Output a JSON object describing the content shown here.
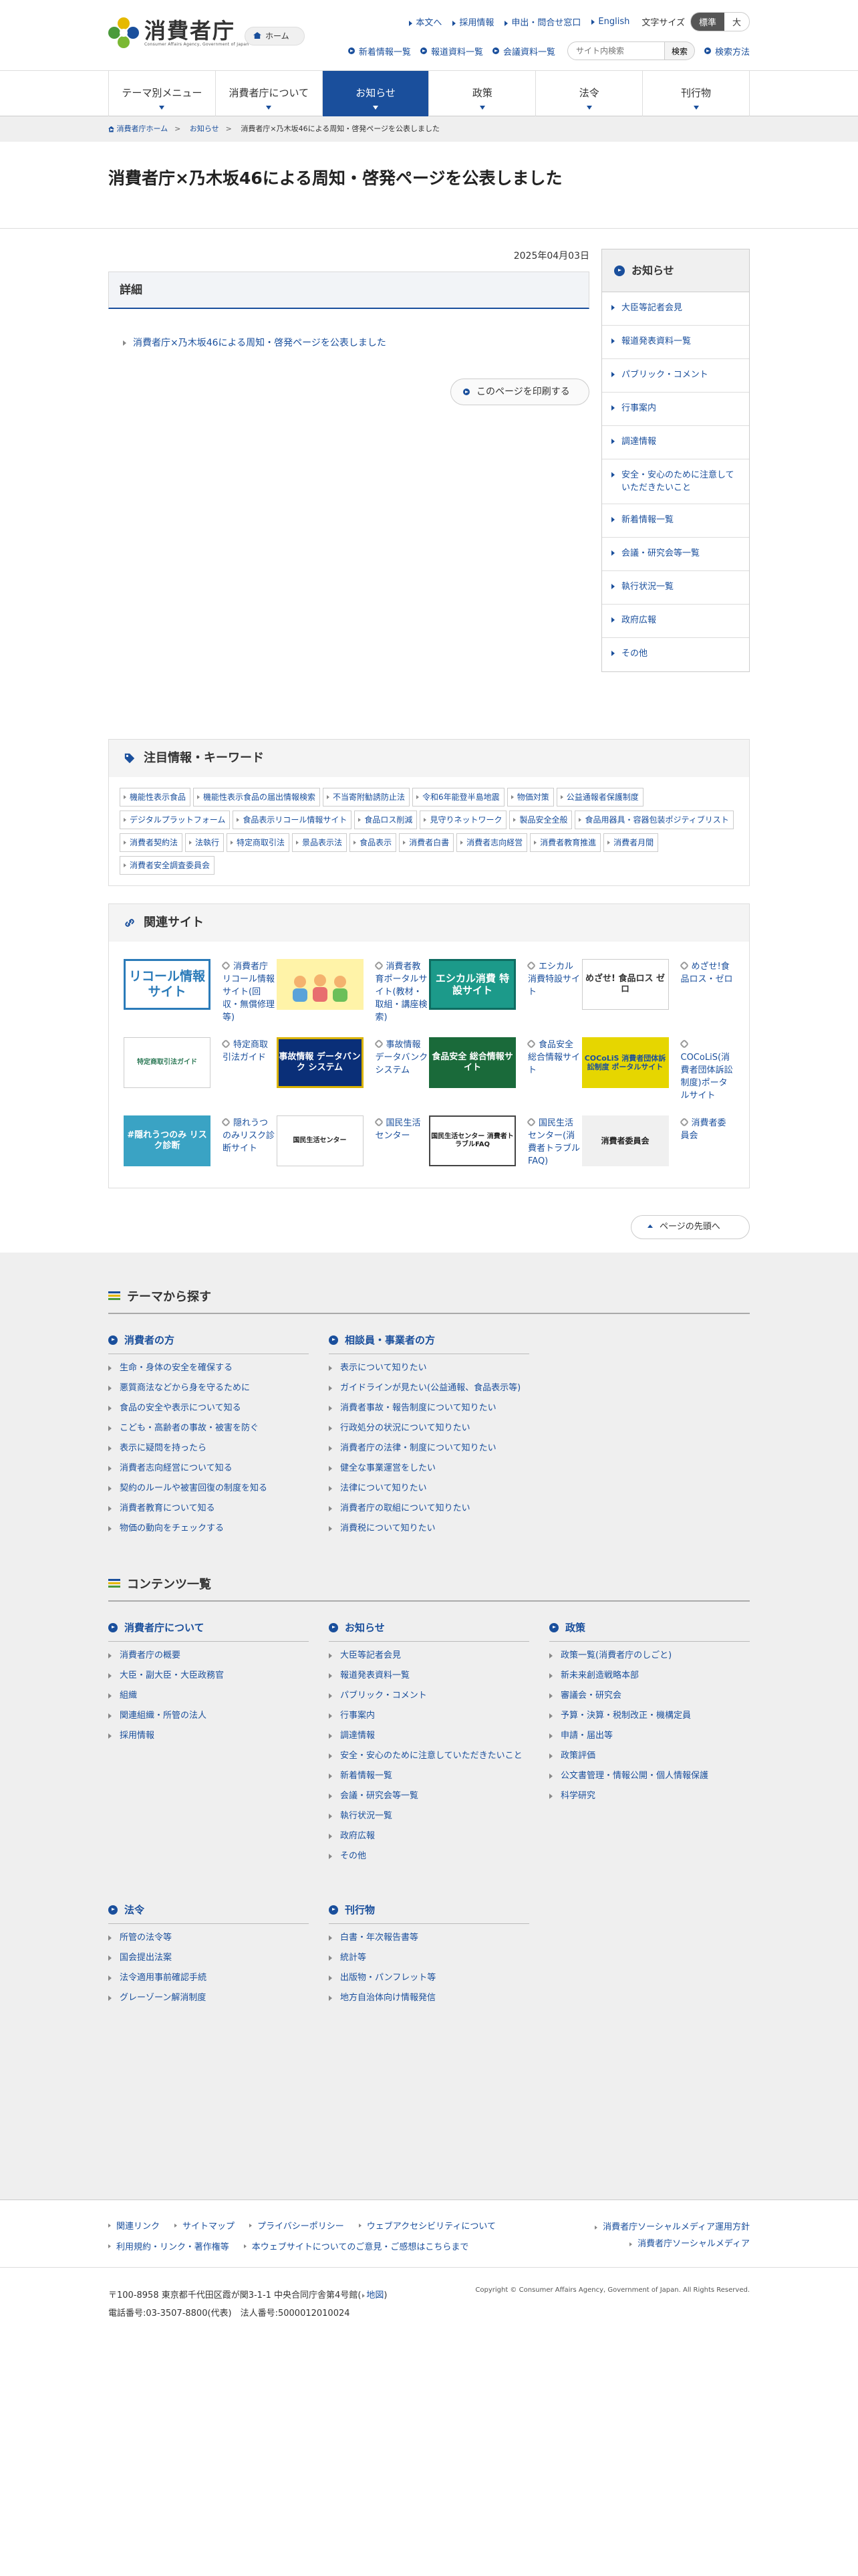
{
  "header": {
    "logo_jp": "消費者庁",
    "logo_en": "Consumer Affairs Agency, Government of Japan",
    "home": "ホーム",
    "util_links": [
      "本文へ",
      "採用情報",
      "申出・問合せ窓口",
      "English"
    ],
    "font_size_label": "文字サイズ",
    "font_size_options": [
      "標準",
      "大"
    ],
    "util2_links": [
      "新着情報一覧",
      "報道資料一覧",
      "会議資料一覧"
    ],
    "search_placeholder": "サイト内検索",
    "search_button": "検索",
    "search_method": "検索方法"
  },
  "nav": [
    "テーマ別メニュー",
    "消費者庁について",
    "お知らせ",
    "政策",
    "法令",
    "刊行物"
  ],
  "breadcrumb": [
    "消費者庁ホーム",
    "お知らせ",
    "消費者庁×乃木坂46による周知・啓発ページを公表しました"
  ],
  "page_title": "消費者庁×乃木坂46による周知・啓発ページを公表しました",
  "date": "2025年04月03日",
  "detail_heading": "詳細",
  "detail_link": "消費者庁×乃木坂46による周知・啓発ページを公表しました",
  "print_button": "このページを印刷する",
  "sidebar": {
    "title": "お知らせ",
    "items": [
      "大臣等記者会見",
      "報道発表資料一覧",
      "パブリック・コメント",
      "行事案内",
      "調達情報",
      "安全・安心のために注意していただきたいこと",
      "新着情報一覧",
      "会議・研究会等一覧",
      "執行状況一覧",
      "政府広報",
      "その他"
    ]
  },
  "keywords": {
    "title": "注目情報・キーワード",
    "items": [
      "機能性表示食品",
      "機能性表示食品の届出情報検索",
      "不当寄附勧誘防止法",
      "令和6年能登半島地震",
      "物価対策",
      "公益通報者保護制度",
      "デジタルプラットフォーム",
      "食品表示リコール情報サイト",
      "食品ロス削減",
      "見守りネットワーク",
      "製品安全全般",
      "食品用器具・容器包装ポジティブリスト",
      "消費者契約法",
      "法執行",
      "特定商取引法",
      "景品表示法",
      "食品表示",
      "消費者白書",
      "消費者志向経営",
      "消費者教育推進",
      "消費者月間",
      "消費者安全調査委員会"
    ]
  },
  "related": {
    "title": "関連サイト",
    "sites": [
      {
        "banner": "リコール情報サイト",
        "text": "消費者庁リコール情報サイト(回収・無償修理等)"
      },
      {
        "banner": "",
        "text": "消費者教育ポータルサイト(教材・取組・講座検索)"
      },
      {
        "banner": "エシカル消費 特設サイト",
        "text": "エシカル消費特設サイト"
      },
      {
        "banner": "めざせ! 食品ロス ゼロ",
        "text": "めざせ!食品ロス・ゼロ"
      },
      {
        "banner": "特定商取引法ガイド",
        "text": "特定商取引法ガイド"
      },
      {
        "banner": "事故情報 データバンク システム",
        "text": "事故情報データバンクシステム"
      },
      {
        "banner": "食品安全 総合情報サイト",
        "text": "食品安全総合情報サイト"
      },
      {
        "banner": "COCoLiS 消費者団体訴訟制度 ポータルサイト",
        "text": "COCoLiS(消費者団体訴訟制度)ポータルサイト"
      },
      {
        "banner": "#隠れうつのみ リスク診断",
        "text": "隠れうつのみリスク診断サイト"
      },
      {
        "banner": "国民生活センター",
        "text": "国民生活センター"
      },
      {
        "banner": "国民生活センター 消費者トラブルFAQ",
        "text": "国民生活センター(消費者トラブルFAQ)"
      },
      {
        "banner": "消費者委員会",
        "text": "消費者委員会"
      }
    ]
  },
  "page_top": "ページの先頭へ",
  "themes": {
    "title": "テーマから探す",
    "cols": [
      {
        "title": "消費者の方",
        "items": [
          "生命・身体の安全を確保する",
          "悪質商法などから身を守るために",
          "食品の安全や表示について知る",
          "こども・高齢者の事故・被害を防ぐ",
          "表示に疑問を持ったら",
          "消費者志向経営について知る",
          "契約のルールや被害回復の制度を知る",
          "消費者教育について知る",
          "物価の動向をチェックする"
        ]
      },
      {
        "title": "相談員・事業者の方",
        "items": [
          "表示について知りたい",
          "ガイドラインが見たい(公益通報、食品表示等)",
          "消費者事故・報告制度について知りたい",
          "行政処分の状況について知りたい",
          "消費者庁の法律・制度について知りたい",
          "健全な事業運営をしたい",
          "法律について知りたい",
          "消費者庁の取組について知りたい",
          "消費税について知りたい"
        ]
      }
    ]
  },
  "contents": {
    "title": "コンテンツ一覧",
    "cols": [
      {
        "title": "消費者庁について",
        "items": [
          "消費者庁の概要",
          "大臣・副大臣・大臣政務官",
          "組織",
          "関連組織・所管の法人",
          "採用情報"
        ]
      },
      {
        "title": "お知らせ",
        "items": [
          "大臣等記者会見",
          "報道発表資料一覧",
          "パブリック・コメント",
          "行事案内",
          "調達情報",
          "安全・安心のために注意していただきたいこと",
          "新着情報一覧",
          "会議・研究会等一覧",
          "執行状況一覧",
          "政府広報",
          "その他"
        ]
      },
      {
        "title": "政策",
        "items": [
          "政策一覧(消費者庁のしごと)",
          "新未来創造戦略本部",
          "審議会・研究会",
          "予算・決算・税制改正・機構定員",
          "申請・届出等",
          "政策評価",
          "公文書管理・情報公開・個人情報保護",
          "科学研究"
        ]
      }
    ],
    "cols2": [
      {
        "title": "法令",
        "items": [
          "所管の法令等",
          "国会提出法案",
          "法令適用事前確認手続",
          "グレーゾーン解消制度"
        ]
      },
      {
        "title": "刊行物",
        "items": [
          "白書・年次報告書等",
          "統計等",
          "出版物・パンフレット等",
          "地方自治体向け情報発信"
        ]
      }
    ]
  },
  "footer": {
    "links": [
      "関連リンク",
      "サイトマップ",
      "プライバシーポリシー",
      "ウェブアクセシビリティについて",
      "利用規約・リンク・著作権等",
      "本ウェブサイトについてのご意見・ご感想はこちらまで"
    ],
    "right_links": [
      "消費者庁ソーシャルメディア運用方針",
      "消費者庁ソーシャルメディア"
    ],
    "address": "〒100-8958 東京都千代田区霞が関3-1-1 中央合同庁舎第4号館(",
    "map": "地図",
    "address_end": ")",
    "phone": "電話番号:03-3507-8800(代表)　法人番号:5000012010024",
    "copyright": "Copyright © Consumer Affairs Agency, Government of Japan. All Rights Reserved."
  }
}
